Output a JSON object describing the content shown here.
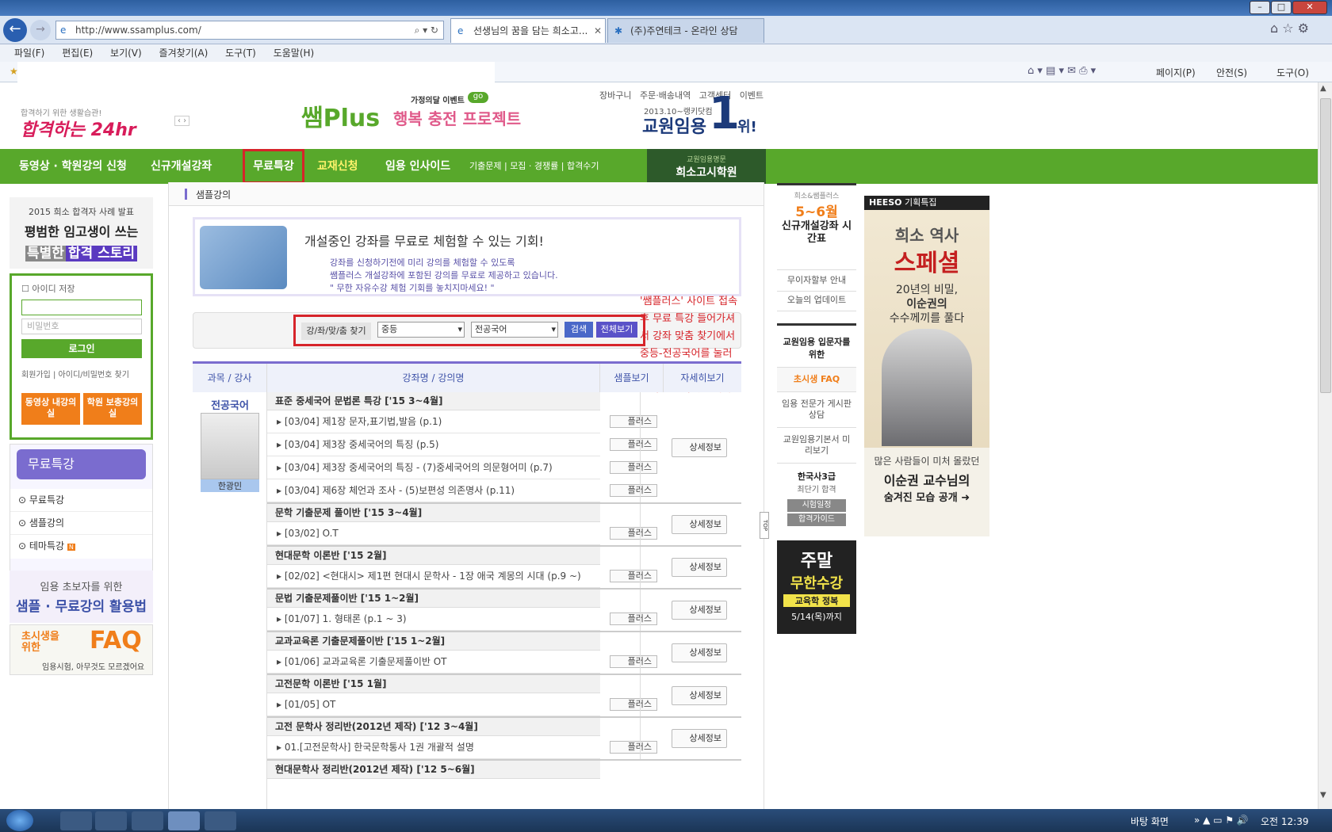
{
  "browser": {
    "url": "http://www.ssamplus.com/",
    "tabs": [
      {
        "label": "선생님의 꿈을 담는 희소고..."
      },
      {
        "label": "(주)주연테크 - 온라인 상담"
      }
    ],
    "menu": [
      "파일(F)",
      "편집(E)",
      "보기(V)",
      "즐겨찾기(A)",
      "도구(T)",
      "도움말(H)"
    ],
    "commands": [
      "페이지(P)",
      "안전(S)",
      "도구(O)"
    ]
  },
  "header": {
    "top_links": [
      "장바구니",
      "주문·배송내역",
      "고객센터",
      "이벤트"
    ],
    "slogan_small": "합격하기 위한 생활습관!",
    "slogan_big": "합격하는 24hr",
    "logo": "쌤Plus",
    "event_tag": "가정의달 이벤트",
    "event_go": "go",
    "event_title": "행복 충전 프로젝트",
    "rank_small": "2013.10~랭키닷컴",
    "rank_label": "교원임용",
    "rank_num": "1",
    "rank_suffix": "위!"
  },
  "gnb": {
    "items": [
      "동영상 · 학원강의 신청",
      "신규개설강좌",
      "무료특강",
      "교재신청",
      "임용 인사이드"
    ],
    "sub_links": [
      "기출문제",
      "모집 · 경쟁률",
      "합격수기"
    ],
    "academy_small": "교원임용명문",
    "academy": "희소고시학원"
  },
  "left": {
    "story_small": "2015 희소 합격자 사례 발표",
    "story_line1": "평범한 임고생이 쓰는",
    "story_line2a": "특별한",
    "story_line2b": "합격 스토리",
    "save_id_label": "아이디 저장",
    "id_placeholder": "",
    "pw_placeholder": "비밀번호",
    "login": "로그인",
    "join": "회원가입",
    "find": "아이디/비밀번호 찾기",
    "btn1": "동영상 내강의실",
    "btn2": "학원 보충강의실",
    "section_title": "무료특강",
    "menu": [
      "무료특강",
      "샘플강의",
      "테마특강"
    ],
    "banner1_small": "임용 초보자를 위한",
    "banner1_big": "샘플 · 무료강의 활용법",
    "banner2_small": "초시생을 위한",
    "banner2_big": "FAQ",
    "banner2_sub": "임용시험, 아무것도 모르겠어요"
  },
  "main": {
    "section": "샘플강의",
    "promo_title": "개설중인 강좌를 무료로 체험할 수 있는 기회!",
    "promo_line1": "강좌를 신청하기전에 미리 강의를 체험할 수 있도록",
    "promo_line2": "쌤플러스 개설강좌에 포함된 강의를 무료로 제공하고 있습니다.",
    "promo_line3": "\" 무한 자유수강 체험 기회를 놓치지마세요! \"",
    "search_label": "강/좌/맞/춤 찾기",
    "select1": "중등",
    "select2": "전공국어",
    "search_btn": "검색",
    "all_btn": "전체보기",
    "annotation": "'쌤플러스' 사이트 접속 후 무료 특강 들어가셔서 강좌 맞춤 찾기에서 중등-전공국어를 눌러주세요 아래에 보면 정동해 인강이 있습니다.",
    "table_headers": [
      "과목 / 강사",
      "강좌명 / 강의명",
      "샘플보기",
      "자세히보기"
    ],
    "subject": "전공국어",
    "teacher": "한광민",
    "plus_label": "플러스",
    "detail_label": "상세정보",
    "courses": [
      {
        "title": "표준 중세국어 문법론 특강 ['15 3~4월]",
        "lectures": [
          "[03/04] 제1장 문자,표기법,발음 (p.1)",
          "[03/04] 제3장 중세국어의 특징 (p.5)",
          "[03/04] 제3장 중세국어의 특징 - (7)중세국어의 의문형어미 (p.7)",
          "[03/04] 제6장 체언과 조사 - (5)보편성 의존명사 (p.11)"
        ]
      },
      {
        "title": "문학 기출문제 풀이반 ['15 3~4월]",
        "lectures": [
          "[03/02] O.T"
        ]
      },
      {
        "title": "현대문학 이론반 ['15 2월]",
        "lectures": [
          "[02/02] <현대시> 제1편 현대시 문학사 - 1장 애국 계몽의 시대 (p.9 ~)"
        ]
      },
      {
        "title": "문법 기출문제풀이반 ['15 1~2월]",
        "lectures": [
          "[01/07] 1. 형태론 (p.1 ~ 3)"
        ]
      },
      {
        "title": "교과교육론 기출문제풀이반 ['15 1~2월]",
        "lectures": [
          "[01/06] 교과교육론 기출문제풀이반 OT"
        ]
      },
      {
        "title": "고전문학 이론반 ['15 1월]",
        "lectures": [
          "[01/05] OT"
        ]
      },
      {
        "title": "고전 문학사 정리반(2012년 제작) ['12 3~4월]",
        "lectures": [
          "01.[고전문학사] 한국문학통사 1권 개괄적 설명"
        ]
      }
    ],
    "cut_row": "현대문학사 정리반(2012년 제작) ['12 5~6월]"
  },
  "right": {
    "box_small": "희소&쌤플러스",
    "box_month": "5~6월",
    "box_title": "신규개설강좌 시간표",
    "items": [
      "무이자할부 안내",
      "오늘의 업데이트"
    ],
    "guide_title": "교원임용 입문자를 위한",
    "faq": "초시생 FAQ",
    "counsel": "임용 전문가 게시판 상담",
    "preview": "교원임용기본서 미리보기",
    "history_title": "한국사3급",
    "history_sub": "최단기 합격",
    "exam_btn": "시험일정",
    "pass_btn": "합격가이드",
    "weekend": "주말",
    "unlimited": "무한수강",
    "edu": "교육학 정복",
    "until": "5/14(목)까지",
    "top": "TOP"
  },
  "ad": {
    "brand": "HEESO",
    "tag": "기획특집",
    "line1": "희소 역사",
    "line2": "스페셜",
    "line3": "20년의 비밀,",
    "line4": "이순권의",
    "line5": "수수께끼를 풀다",
    "line6": "많은 사람들이 미처 몰랐던",
    "line7": "이순권 교수님의",
    "line8": "숨겨진 모습 공개"
  },
  "taskbar": {
    "desktop": "바탕 화면",
    "time": "오전 12:39"
  },
  "colors": {
    "green": "#58a82b",
    "purple": "#7a6ccf",
    "red": "#d6242a",
    "orange": "#f07e1a"
  }
}
